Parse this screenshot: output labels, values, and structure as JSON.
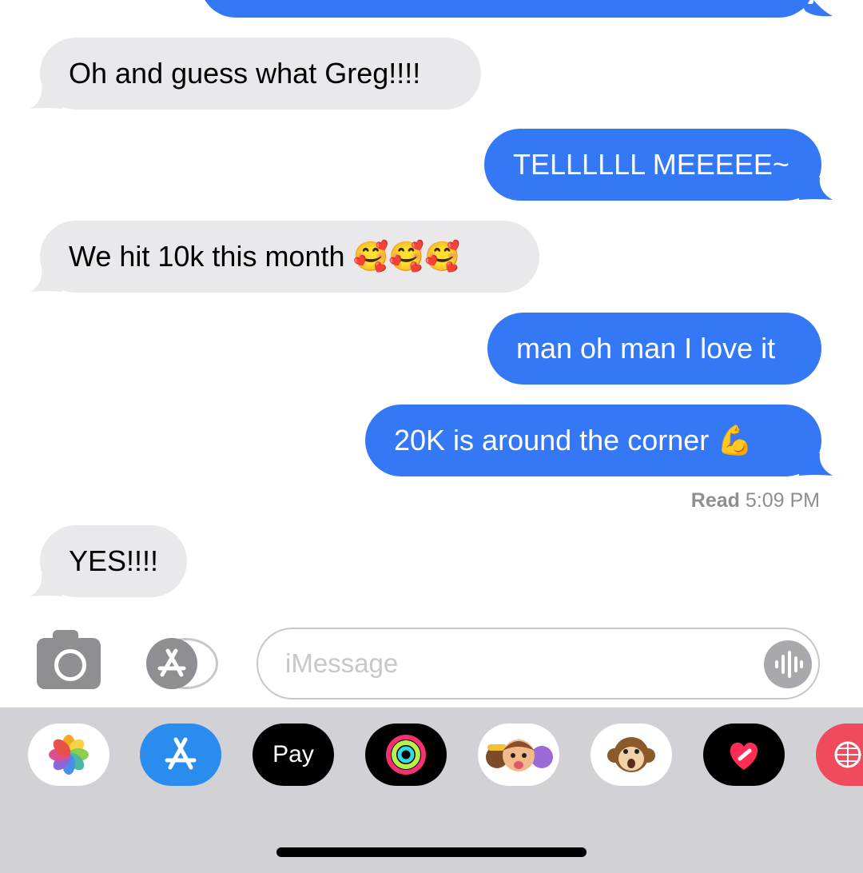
{
  "messages": [
    {
      "direction": "incoming",
      "text": "Oh and guess what Greg!!!!"
    },
    {
      "direction": "outgoing",
      "text": "TELLLLLL MEEEEE~"
    },
    {
      "direction": "incoming",
      "text": "We hit 10k this month 🥰🥰🥰"
    },
    {
      "direction": "outgoing",
      "text": "man oh man I love it"
    },
    {
      "direction": "outgoing",
      "text": "20K is around the corner 💪"
    },
    {
      "direction": "incoming",
      "text": "YES!!!!"
    }
  ],
  "read_receipt": {
    "label": "Read",
    "time": "5:09 PM"
  },
  "composer": {
    "placeholder": "iMessage"
  },
  "app_drawer": {
    "apps": [
      {
        "name": "Photos",
        "icon": "photos-icon"
      },
      {
        "name": "App Store",
        "icon": "app-store-icon"
      },
      {
        "name": "Apple Pay",
        "icon": "apple-pay-icon",
        "label": "Pay"
      },
      {
        "name": "Activity",
        "icon": "activity-rings-icon"
      },
      {
        "name": "Memoji Stickers",
        "icon": "memoji-icon"
      },
      {
        "name": "Animoji",
        "icon": "monkey-animoji-icon"
      },
      {
        "name": "Digital Touch",
        "icon": "digital-touch-heart-icon"
      },
      {
        "name": "Web Search",
        "icon": "globe-search-icon"
      }
    ]
  },
  "colors": {
    "outgoing": "#3478f6",
    "incoming": "#e9e9eb",
    "drawer": "#d1d1d6"
  }
}
